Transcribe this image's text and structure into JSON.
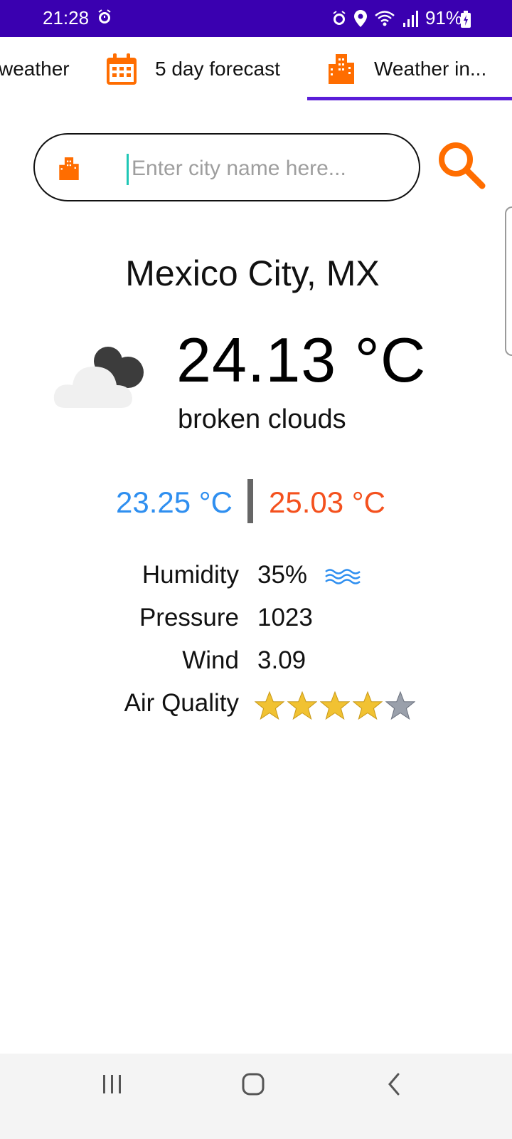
{
  "status_bar": {
    "time": "21:28",
    "battery": "91%",
    "icons": [
      "alarm-icon",
      "location-icon",
      "wifi-icon",
      "signal-icon",
      "battery-icon"
    ]
  },
  "tabs": [
    {
      "label": "weather",
      "icon": "sun-icon",
      "selected": false
    },
    {
      "label": "5 day forecast",
      "icon": "calendar-icon",
      "selected": false
    },
    {
      "label": "Weather in...",
      "icon": "city-icon",
      "selected": true
    }
  ],
  "search": {
    "placeholder": "Enter city name here...",
    "value": "",
    "icon": "city-icon",
    "button_icon": "search-icon"
  },
  "weather": {
    "city": "Mexico City, MX",
    "temperature": "24.13 °C",
    "description": "broken clouds",
    "icon": "broken-clouds-icon",
    "temp_min": "23.25 °C",
    "temp_max": "25.03 °C"
  },
  "details": {
    "humidity_label": "Humidity",
    "humidity_value": "35%",
    "pressure_label": "Pressure",
    "pressure_value": "1023",
    "wind_label": "Wind",
    "wind_value": "3.09",
    "air_quality_label": "Air Quality",
    "air_quality_rating": 4,
    "air_quality_max": 5
  },
  "colors": {
    "status_bar": "#3a00b0",
    "accent_orange": "#ff6d00",
    "tab_indicator": "#5a1ed8",
    "temp_min": "#2f8ff0",
    "temp_max": "#f4511e"
  },
  "nav_bar": {
    "buttons": [
      "recents-icon",
      "home-icon",
      "back-icon"
    ]
  }
}
